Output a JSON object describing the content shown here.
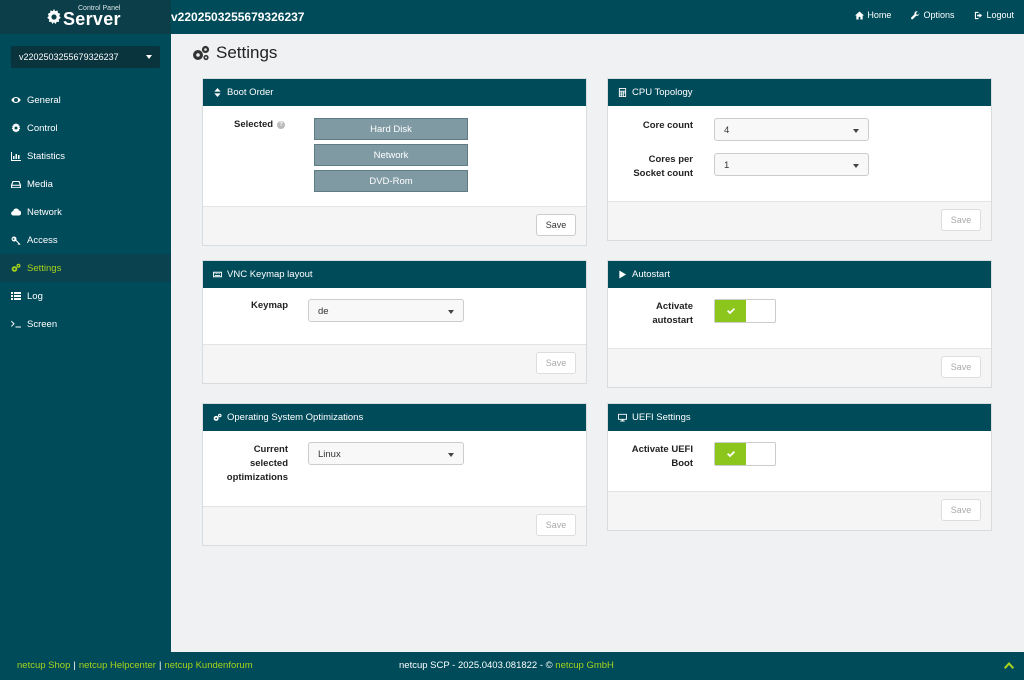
{
  "header": {
    "logo_small": "Control Panel",
    "logo_big": "Server",
    "title": "v2202503255679326237",
    "nav": {
      "home": "Home",
      "options": "Options",
      "logout": "Logout"
    }
  },
  "sidebar": {
    "server_select": "v2202503255679326237",
    "items": [
      {
        "label": "General",
        "icon": "eye-icon"
      },
      {
        "label": "Control",
        "icon": "gear-icon"
      },
      {
        "label": "Statistics",
        "icon": "bar-chart-icon"
      },
      {
        "label": "Media",
        "icon": "drive-icon"
      },
      {
        "label": "Network",
        "icon": "cloud-icon"
      },
      {
        "label": "Access",
        "icon": "key-icon"
      },
      {
        "label": "Settings",
        "icon": "gears-icon",
        "active": true
      },
      {
        "label": "Log",
        "icon": "list-icon"
      },
      {
        "label": "Screen",
        "icon": "terminal-icon"
      }
    ]
  },
  "page": {
    "title": "Settings"
  },
  "panels": {
    "boot_order": {
      "title": "Boot Order",
      "label": "Selected",
      "items": [
        "Hard Disk",
        "Network",
        "DVD-Rom"
      ],
      "save": "Save"
    },
    "cpu_topology": {
      "title": "CPU Topology",
      "core_count_label": "Core count",
      "core_count_value": "4",
      "cores_per_socket_label_1": "Cores per",
      "cores_per_socket_label_2": "Socket count",
      "cores_per_socket_value": "1",
      "save": "Save"
    },
    "vnc_keymap": {
      "title": "VNC Keymap layout",
      "label": "Keymap",
      "value": "de",
      "save": "Save"
    },
    "autostart": {
      "title": "Autostart",
      "label_1": "Activate",
      "label_2": "autostart",
      "enabled": true,
      "save": "Save"
    },
    "os_optimizations": {
      "title": "Operating System Optimizations",
      "label_1": "Current",
      "label_2": "selected",
      "label_3": "optimizations",
      "value": "Linux",
      "save": "Save"
    },
    "uefi": {
      "title": "UEFI Settings",
      "label_1": "Activate UEFI",
      "label_2": "Boot",
      "enabled": true,
      "save": "Save"
    }
  },
  "footer": {
    "links": [
      "netcup Shop",
      "netcup Helpcenter",
      "netcup Kundenforum"
    ],
    "version": "netcup SCP - 2025.0403.081822 - ©",
    "company": "netcup GmbH"
  },
  "colors": {
    "primary": "#004b5a",
    "accent": "#a6d31a",
    "toggle_on": "#8cc51c"
  }
}
